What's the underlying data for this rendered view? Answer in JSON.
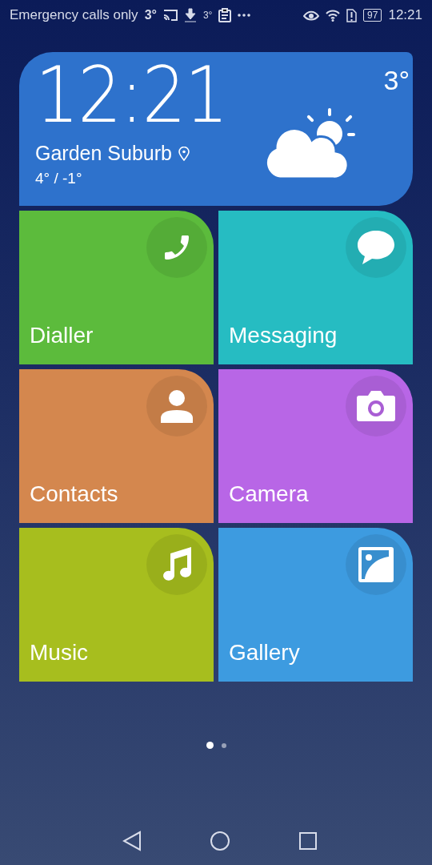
{
  "status_bar": {
    "carrier": "Emergency calls only",
    "temp": "3°",
    "small_temp": "3°",
    "battery": "97",
    "time": "12:21"
  },
  "weather": {
    "time": "12:21",
    "location": "Garden Suburb",
    "range": "4° / -1°",
    "current": "3°"
  },
  "apps": [
    {
      "label": "Dialler",
      "kind": "phone",
      "color": "#5cbb3c"
    },
    {
      "label": "Messaging",
      "kind": "message",
      "color": "#26bcc2"
    },
    {
      "label": "Contacts",
      "kind": "contact",
      "color": "#d4874e"
    },
    {
      "label": "Camera",
      "kind": "camera",
      "color": "#b866e6"
    },
    {
      "label": "Music",
      "kind": "music",
      "color": "#a7be1e"
    },
    {
      "label": "Gallery",
      "kind": "gallery",
      "color": "#3d9be0"
    }
  ],
  "pages": [
    {
      "selected": true
    },
    {
      "selected": false
    }
  ]
}
